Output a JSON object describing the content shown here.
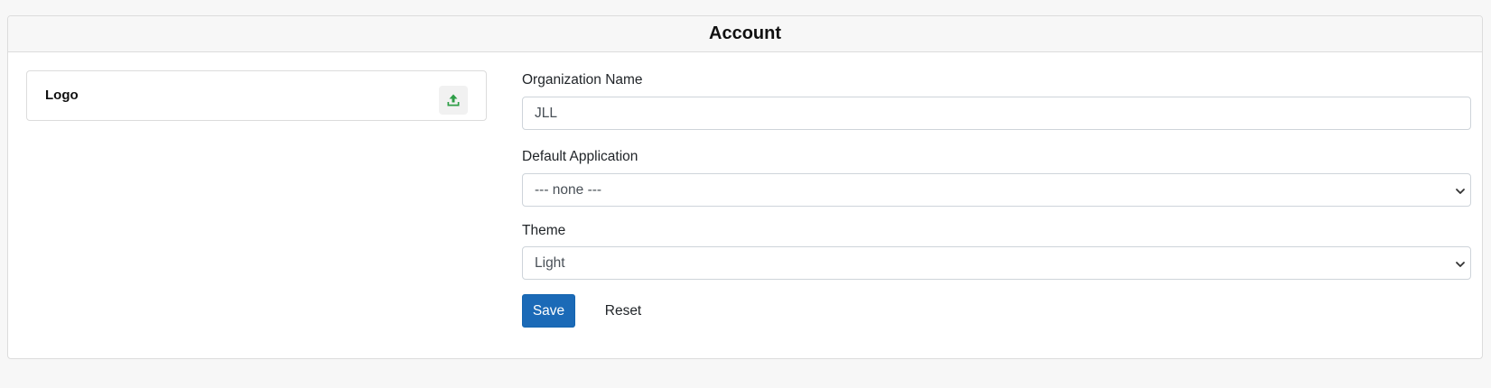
{
  "card": {
    "title": "Account"
  },
  "logo": {
    "label": "Logo",
    "upload_icon": "upload-icon",
    "upload_icon_color": "#2e9e47"
  },
  "form": {
    "organization_name": {
      "label": "Organization Name",
      "value": "JLL"
    },
    "default_application": {
      "label": "Default Application",
      "selected": "--- none ---"
    },
    "theme": {
      "label": "Theme",
      "selected": "Light"
    },
    "save_label": "Save",
    "reset_label": "Reset"
  },
  "colors": {
    "primary": "#1b6ab7",
    "page_background": "#f7f7f7",
    "border": "#dcdcdc"
  }
}
